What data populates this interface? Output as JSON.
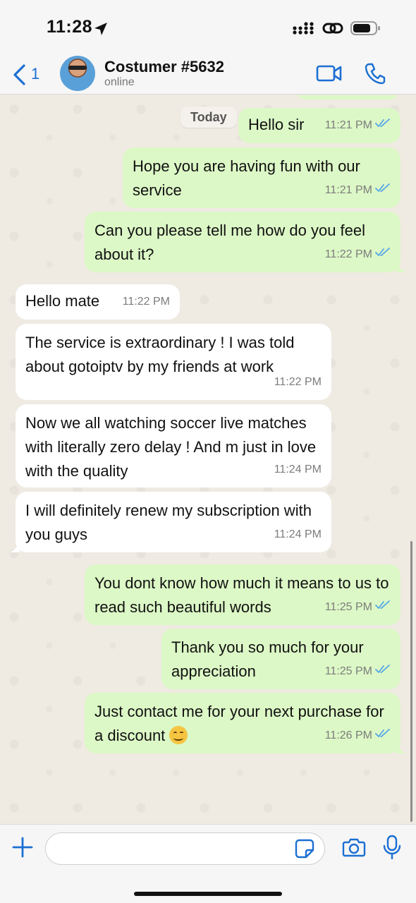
{
  "status_bar": {
    "time": "11:28"
  },
  "header": {
    "back_count": "1",
    "contact_name": "Costumer #5632",
    "contact_status": "online"
  },
  "chat": {
    "date_chip": "Today",
    "messages": [
      {
        "direction": "out",
        "text": "Hello sir",
        "time": "11:21 PM"
      },
      {
        "direction": "out",
        "text": "Hope you are having fun with our service",
        "time": "11:21 PM"
      },
      {
        "direction": "out",
        "text": "Can you please tell me how do you feel about it?",
        "time": "11:22 PM"
      },
      {
        "direction": "in",
        "text": "Hello mate",
        "time": "11:22 PM"
      },
      {
        "direction": "in",
        "text": "The service is extraordinary ! I was told about gotoiptv by my friends at work",
        "time": "11:22 PM"
      },
      {
        "direction": "in",
        "text": "Now we all watching soccer live matches with literally zero delay ! And m just in love with the quality",
        "time": "11:24 PM"
      },
      {
        "direction": "in",
        "text": "I will definitely renew my subscription with you guys",
        "time": "11:24 PM"
      },
      {
        "direction": "out",
        "text": "You dont know how much it means to us to read such beautiful words",
        "time": "11:25 PM"
      },
      {
        "direction": "out",
        "text": "Thank you so much for your appreciation",
        "time": "11:25 PM"
      },
      {
        "direction": "out",
        "text": "Just contact me for your next purchase for a discount",
        "time": "11:26 PM"
      }
    ]
  },
  "colors": {
    "outgoing_bubble": "#dcf8c6",
    "incoming_bubble": "#ffffff",
    "accent_blue": "#1b6fd3",
    "read_checks": "#53a6e8"
  },
  "icons": {
    "status": [
      "location-arrow-icon",
      "signal-icon",
      "link-icon",
      "battery-icon"
    ],
    "header": [
      "chevron-left-icon",
      "video-camera-icon",
      "phone-icon"
    ],
    "input": [
      "plus-icon",
      "sticker-icon",
      "camera-icon",
      "microphone-icon"
    ],
    "emoji": "smiling-face-emoji"
  }
}
